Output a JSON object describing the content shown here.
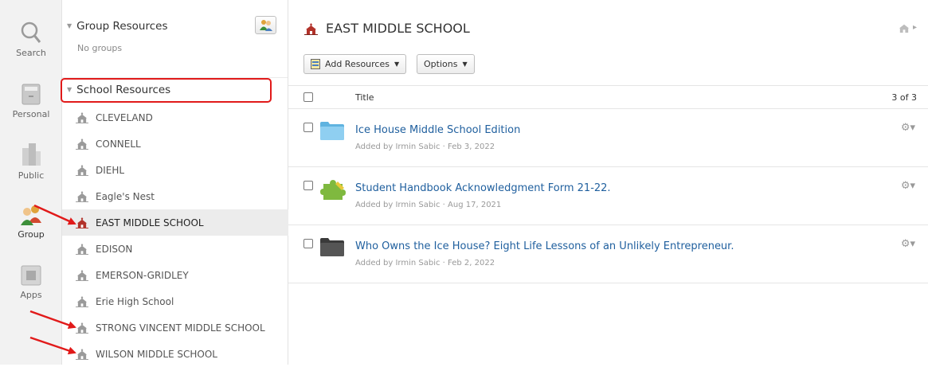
{
  "rail": {
    "items": [
      {
        "label": "Search",
        "icon": "search-icon"
      },
      {
        "label": "Personal",
        "icon": "personal-icon"
      },
      {
        "label": "Public",
        "icon": "public-icon"
      },
      {
        "label": "Group",
        "icon": "group-icon"
      },
      {
        "label": "Apps",
        "icon": "apps-icon"
      }
    ]
  },
  "tree": {
    "group_header": "Group Resources",
    "no_groups": "No groups",
    "school_header": "School Resources",
    "schools": [
      "CLEVELAND",
      "CONNELL",
      "DIEHL",
      "Eagle's Nest",
      "EAST MIDDLE SCHOOL",
      "EDISON",
      "EMERSON-GRIDLEY",
      "Erie High School",
      "STRONG VINCENT MIDDLE SCHOOL",
      "WILSON MIDDLE SCHOOL"
    ],
    "selected_index": 4
  },
  "main": {
    "title": "EAST MIDDLE SCHOOL",
    "add_resources": "Add Resources",
    "options": "Options",
    "col_title": "Title",
    "count": "3 of 3",
    "rows": [
      {
        "title": "Ice House Middle School Edition",
        "meta": "Added by Irmin Sabic · Feb 3, 2022",
        "icon": "folder-blue-icon"
      },
      {
        "title": "Student Handbook Acknowledgment Form 21-22.",
        "meta": "Added by Irmin Sabic · Aug 17, 2021",
        "icon": "puzzle-icon"
      },
      {
        "title": "Who Owns the Ice House? Eight Life Lessons of an Unlikely Entrepreneur.",
        "meta": "Added by Irmin Sabic · Feb 2, 2022",
        "icon": "folder-dark-icon"
      }
    ]
  },
  "colors": {
    "accent": "#1f5f9e",
    "annotation": "#e11a1a",
    "school_red": "#b2322a"
  }
}
